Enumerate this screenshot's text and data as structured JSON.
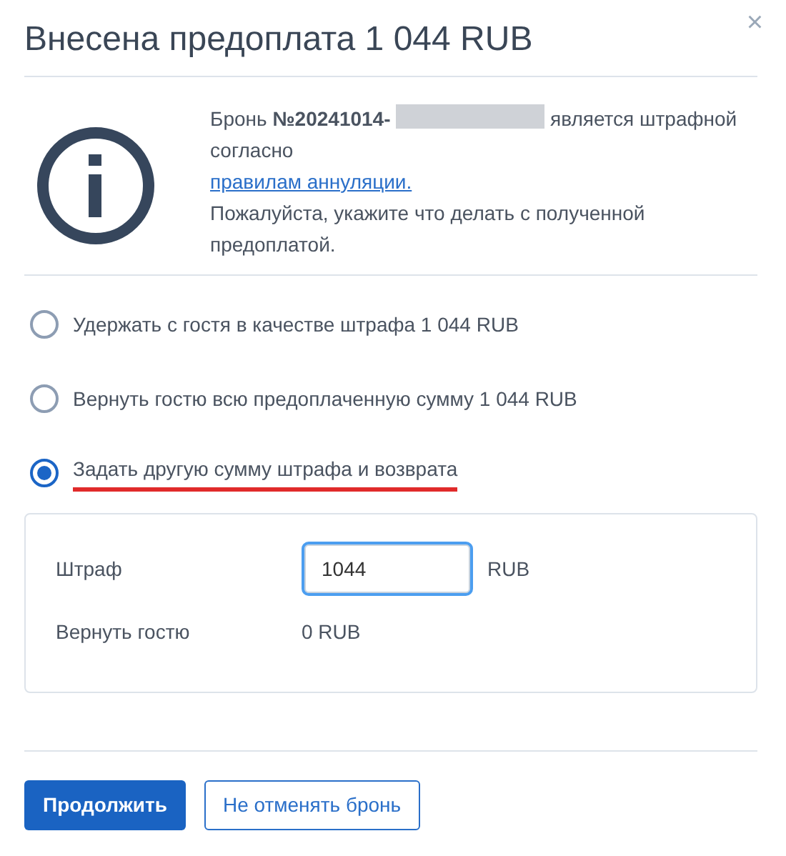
{
  "dialog": {
    "title": "Внесена предоплата 1 044 RUB",
    "close": "×"
  },
  "message": {
    "parts": [
      {
        "kind": "text",
        "text": "Бронь **№20241014-**"
      },
      {
        "kind": "redacted"
      },
      {
        "kind": "text",
        "text": "является штрафной"
      },
      {
        "kind": "text",
        "text": "согласно"
      }
    ],
    "link": "правилам аннуляции.",
    "note": "Пожалуйста, укажите что делать с полученной предоплатой."
  },
  "options": [
    {
      "label": "Удержать с гостя в качестве штрафа 1 044 RUB",
      "selected": false,
      "underlined": false
    },
    {
      "label": "Вернуть гостю всю предоплаченную сумму 1 044 RUB",
      "selected": false,
      "underlined": false
    },
    {
      "label": "Задать другую сумму штрафа и возврата",
      "selected": true,
      "underlined": true
    }
  ],
  "custom": {
    "penalty_label": "Штраф",
    "penalty_value": "1044",
    "penalty_unit": "RUB",
    "refund_label": "Вернуть гостю",
    "refund_value": "0 RUB"
  },
  "buttons": [
    {
      "kind": "primary",
      "label": "Продолжить"
    },
    {
      "kind": "outline",
      "label": "Не отменять бронь"
    }
  ]
}
